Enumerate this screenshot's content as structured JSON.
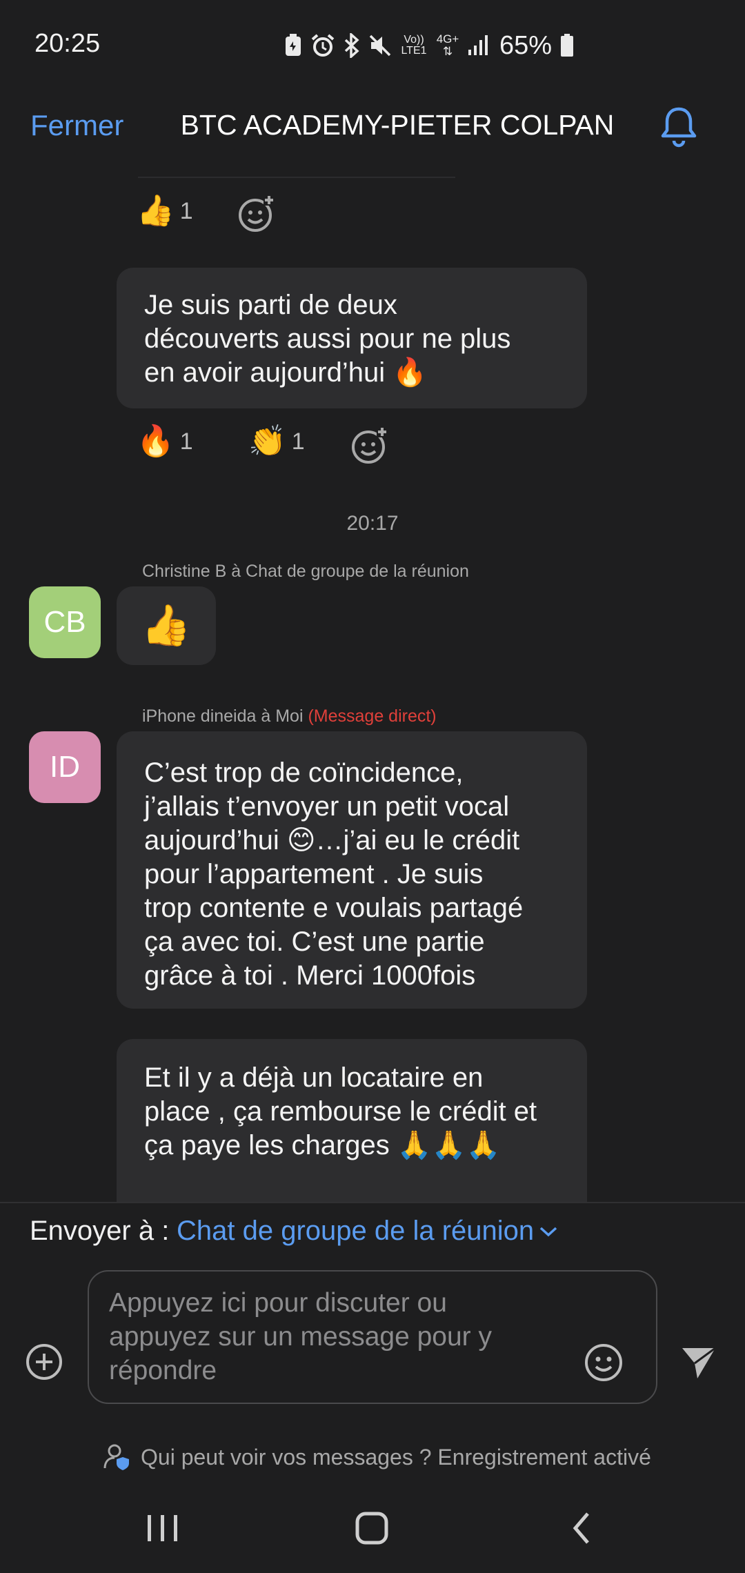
{
  "status_bar": {
    "time": "20:25",
    "network_volte": "Vo)) LTE1",
    "network_4g": "4G+",
    "battery": "65%",
    "icons": [
      "battery-saver-icon",
      "alarm-icon",
      "bluetooth-icon",
      "mute-icon",
      "volte-icon",
      "4g-icon",
      "signal-icon",
      "battery-icon"
    ]
  },
  "header": {
    "close_label": "Fermer",
    "title": "BTC ACADEMY-PIETER COLPAN",
    "bell_icon": "bell-icon"
  },
  "messages": {
    "reaction_top": {
      "emoji": "👍",
      "count": "1"
    },
    "bubble1": {
      "lines": [
        "Je suis parti de deux",
        "découverts aussi pour ne plus",
        "en avoir aujourd’hui 🔥"
      ]
    },
    "reactions_2": [
      {
        "emoji": "🔥",
        "count": "1"
      },
      {
        "emoji": "👏",
        "count": "1"
      }
    ],
    "timestamp": "20:17",
    "cb": {
      "sender": "Christine B à Chat de groupe de la réunion",
      "avatar_initials": "CB",
      "avatar_color": "#a3cf79",
      "content": "👍"
    },
    "id": {
      "sender": "iPhone dineida à Moi",
      "direct_label": "(Message direct)",
      "avatar_initials": "ID",
      "avatar_color": "#d78db0",
      "lines": [
        "C’est trop de coïncidence,",
        "j’allais t’envoyer un petit vocal",
        "aujourd’hui 😊…j’ai eu le crédit",
        "pour l’appartement . Je suis",
        "trop contente e voulais partagé",
        "ça avec toi. C’est une partie",
        "grâce à toi . Merci 1000fois"
      ],
      "lines2": [
        "Et il y a déjà un locataire en",
        "place , ça rembourse le crédit et",
        "ça paye les charges 🙏🙏🙏"
      ]
    }
  },
  "compose": {
    "send_to_label": "Envoyer à :",
    "send_to_target": "Chat de groupe de la réunion",
    "placeholder_lines": [
      "Appuyez ici pour discuter ou",
      "appuyez sur un message pour y",
      "répondre"
    ],
    "privacy_text": "Qui peut voir vos messages ? Enregistrement activé"
  },
  "colors": {
    "accent": "#5b9cf0",
    "background": "#1e1e1f",
    "bubble": "#2d2d2f",
    "direct_message": "#e0403a"
  }
}
